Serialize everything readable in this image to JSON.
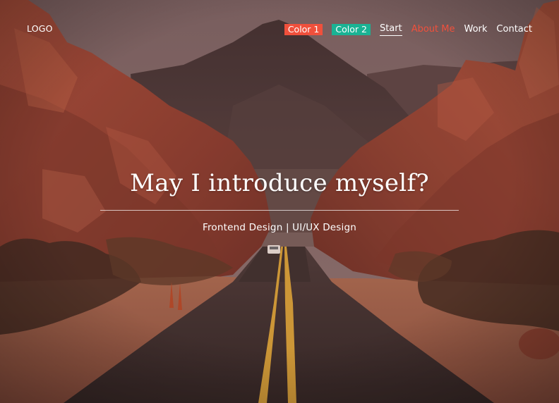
{
  "header": {
    "logo": "LOGO",
    "nav": {
      "color1_label": "Color 1",
      "color2_label": "Color 2",
      "start_label": "Start",
      "about_label": "About Me",
      "work_label": "Work",
      "contact_label": "Contact"
    }
  },
  "hero": {
    "title": "May I introduce myself?",
    "subtitle": "Frontend Design | UI/UX Design"
  },
  "colors": {
    "color1": "#f0503c",
    "color2": "#1ab394",
    "accent": "#f0503c"
  }
}
